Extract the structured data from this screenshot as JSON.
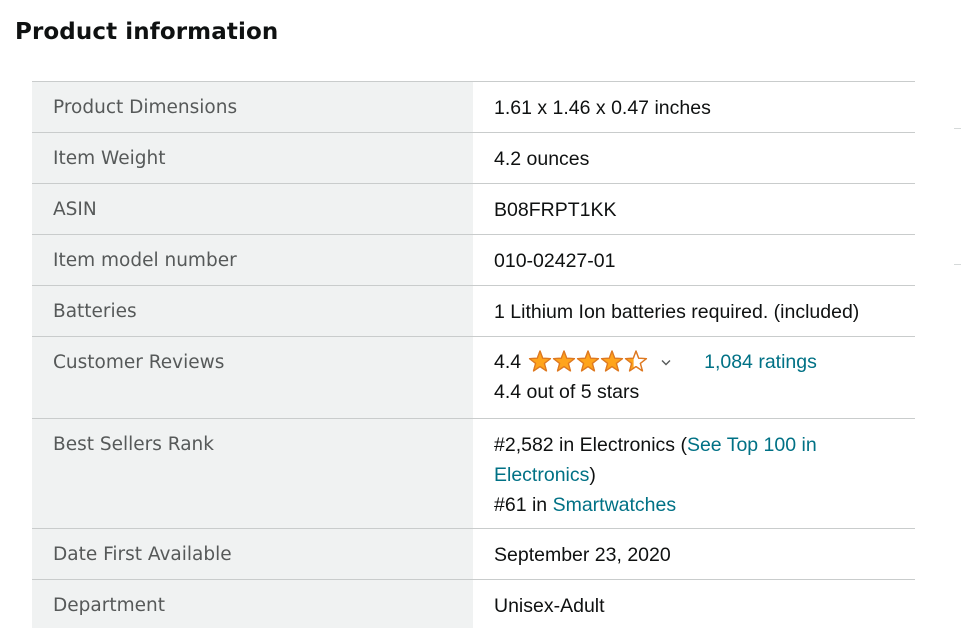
{
  "title": "Product information",
  "rows": [
    {
      "label": "Product Dimensions",
      "value": "1.61 x 1.46 x 0.47 inches"
    },
    {
      "label": "Item Weight",
      "value": "4.2 ounces"
    },
    {
      "label": "ASIN",
      "value": "B08FRPT1KK"
    },
    {
      "label": "Item model number",
      "value": "010-02427-01"
    },
    {
      "label": "Batteries",
      "value": "1 Lithium Ion batteries required. (included)"
    }
  ],
  "reviews": {
    "label": "Customer Reviews",
    "rating": "4.4",
    "rating_stars": 4.4,
    "ratings_link": "1,084 ratings",
    "stars_text": "4.4 out of 5 stars"
  },
  "rank": {
    "label": "Best Sellers Rank",
    "line1_prefix": "#2,582 in Electronics (",
    "line1_link": "See Top 100 in Electronics",
    "line1_suffix": ")",
    "line2_prefix": "#61 in ",
    "line2_link": "Smartwatches"
  },
  "rows_after": [
    {
      "label": "Date First Available",
      "value": "September 23, 2020"
    },
    {
      "label": "Department",
      "value": "Unisex-Adult"
    }
  ],
  "colors": {
    "link": "#007185",
    "star": "#ffa41c",
    "star_outline": "#de7921",
    "label_bg": "#f0f2f2"
  },
  "icons": {
    "stars": "star-rating-icon",
    "dropdown": "chevron-down-icon"
  }
}
